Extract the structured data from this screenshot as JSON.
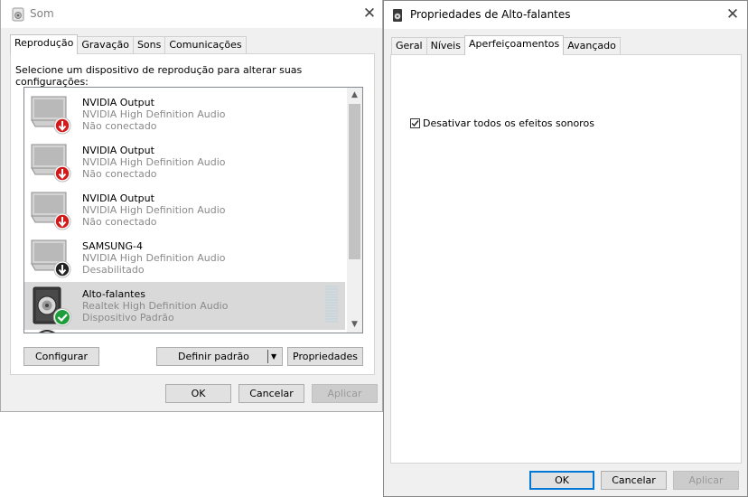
{
  "som": {
    "title": "Som",
    "tabs": [
      "Reprodução",
      "Gravação",
      "Sons",
      "Comunicações"
    ],
    "instruction": "Selecione um dispositivo de reprodução para alterar suas configurações:",
    "devices": [
      {
        "name": "NVIDIA Output",
        "driver": "NVIDIA High Definition Audio",
        "status": "Não conectado",
        "icon": "monitor-icon",
        "badge": "red-down-arrow"
      },
      {
        "name": "NVIDIA Output",
        "driver": "NVIDIA High Definition Audio",
        "status": "Não conectado",
        "icon": "monitor-icon",
        "badge": "red-down-arrow"
      },
      {
        "name": "NVIDIA Output",
        "driver": "NVIDIA High Definition Audio",
        "status": "Não conectado",
        "icon": "monitor-icon",
        "badge": "red-down-arrow"
      },
      {
        "name": "SAMSUNG-4",
        "driver": "NVIDIA High Definition Audio",
        "status": "Desabilitado",
        "icon": "monitor-icon",
        "badge": "black-down-arrow"
      },
      {
        "name": "Alto-falantes",
        "driver": "Realtek High Definition Audio",
        "status": "Dispositivo Padrão",
        "icon": "speaker-icon",
        "badge": "green-check",
        "selected": true
      }
    ],
    "buttons": {
      "configure": "Configurar",
      "set_default": "Definir padrão",
      "properties": "Propriedades",
      "ok": "OK",
      "cancel": "Cancelar",
      "apply": "Aplicar"
    }
  },
  "props": {
    "title": "Propriedades de Alto-falantes",
    "tabs": [
      "Geral",
      "Níveis",
      "Aperfeiçoamentos",
      "Avançado"
    ],
    "checkbox_label": "Desativar todos os efeitos sonoros",
    "checkbox_checked": true,
    "buttons": {
      "ok": "OK",
      "cancel": "Cancelar",
      "apply": "Aplicar"
    }
  }
}
